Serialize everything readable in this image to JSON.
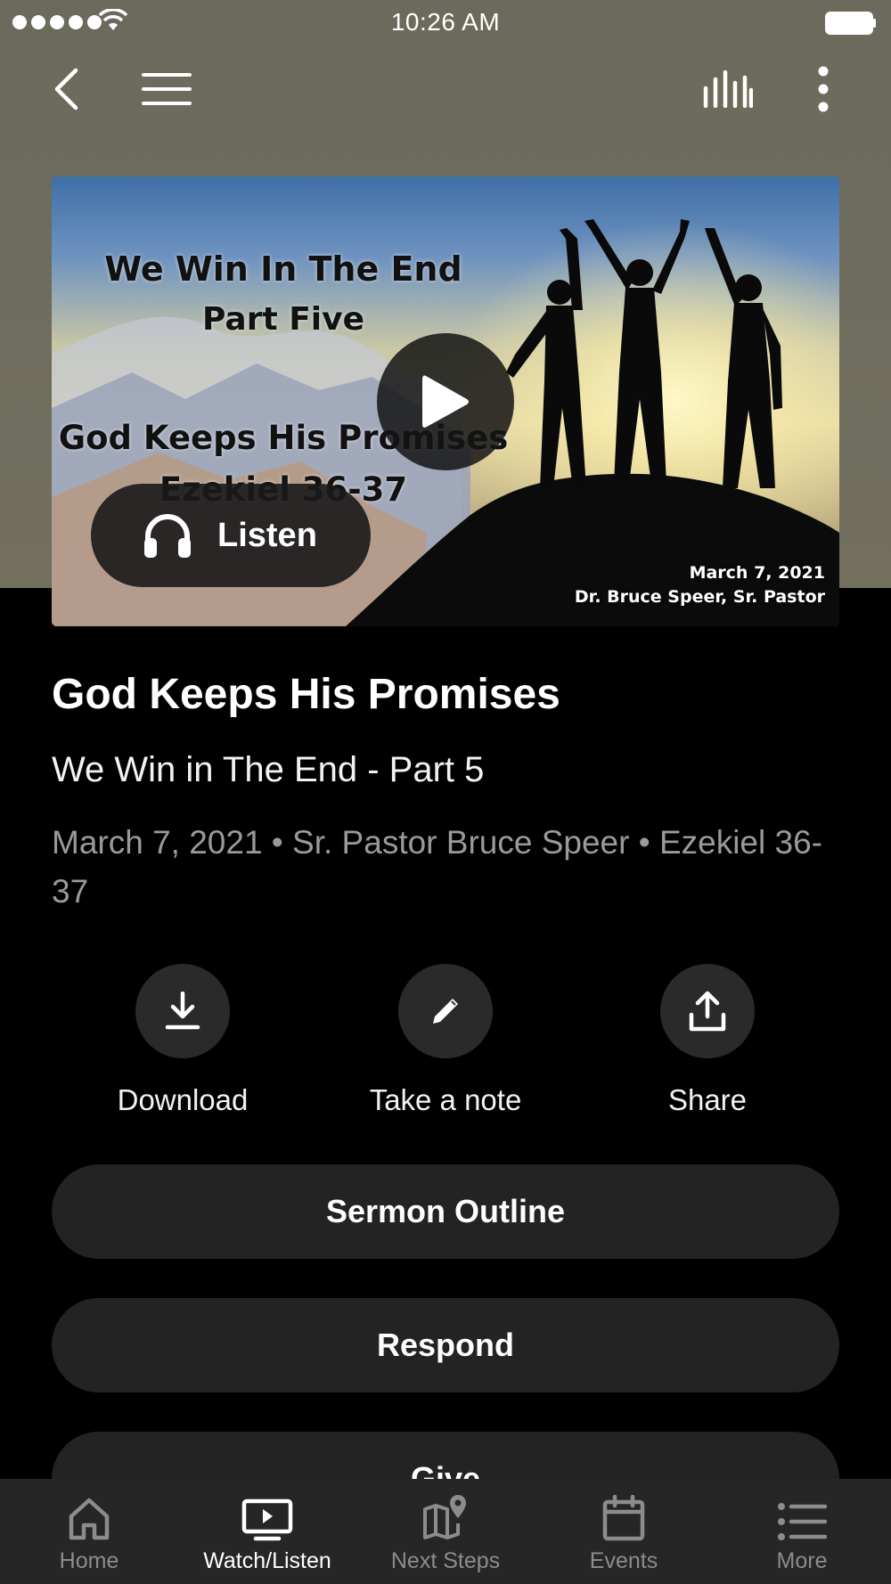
{
  "status_bar": {
    "time": "10:26 AM"
  },
  "video": {
    "thumbnail_lines": [
      "We Win In The End",
      "Part Five",
      "God Keeps His Promises",
      "Ezekiel 36-37"
    ],
    "thumbnail_date": "March 7, 2021",
    "thumbnail_speaker": "Dr. Bruce Speer, Sr. Pastor",
    "listen_label": "Listen"
  },
  "sermon": {
    "title": "God Keeps His Promises",
    "subtitle": "We Win in The End - Part 5",
    "meta": "March 7, 2021 • Sr. Pastor Bruce Speer • Ezekiel 36-37"
  },
  "actions": [
    {
      "label": "Download",
      "icon": "download-icon"
    },
    {
      "label": "Take a note",
      "icon": "pencil-icon"
    },
    {
      "label": "Share",
      "icon": "share-icon"
    }
  ],
  "buttons": {
    "outline": "Sermon Outline",
    "respond": "Respond",
    "give": "Give"
  },
  "tabs": [
    {
      "label": "Home",
      "icon": "home-icon"
    },
    {
      "label": "Watch/Listen",
      "icon": "watch-icon",
      "active": true
    },
    {
      "label": "Next Steps",
      "icon": "map-icon"
    },
    {
      "label": "Events",
      "icon": "calendar-icon"
    },
    {
      "label": "More",
      "icon": "list-icon"
    }
  ],
  "colors": {
    "header_bg": "#6b6a5c",
    "background": "#000000",
    "pill_bg": "#232323",
    "tabbar_bg": "#262626",
    "tab_inactive": "#8c8c8c"
  }
}
